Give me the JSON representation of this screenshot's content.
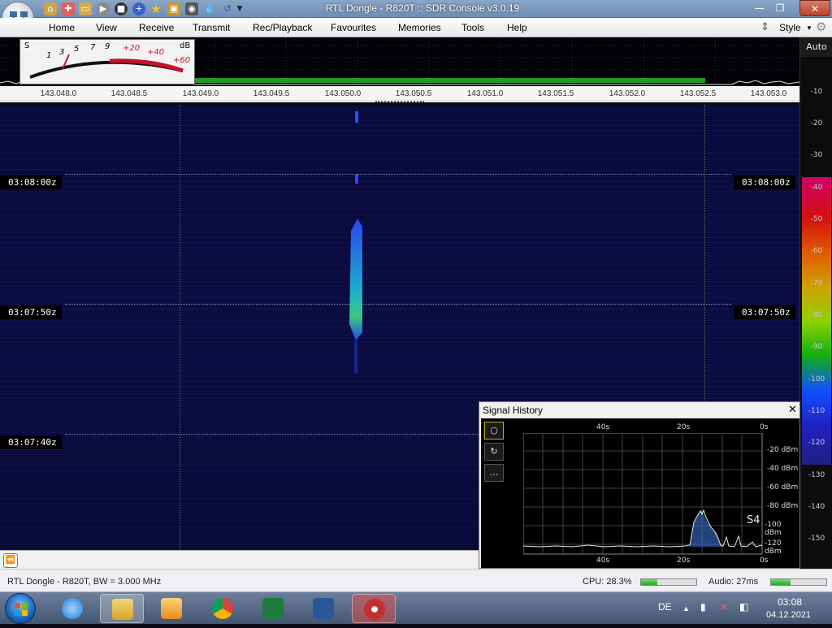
{
  "window": {
    "title": "RTL Dongle - R820T :: SDR Console v3.0.19",
    "style_label": "Style"
  },
  "menu": [
    "Home",
    "View",
    "Receive",
    "Transmit",
    "Rec/Playback",
    "Favourites",
    "Memories",
    "Tools",
    "Help"
  ],
  "smeter": {
    "s_label": "S",
    "db_label": "dB",
    "s_scale": [
      "1",
      "3",
      "5",
      "7",
      "9"
    ],
    "db_scale": [
      "+20",
      "+40",
      "+60"
    ]
  },
  "frequency_axis": [
    "143.048.0",
    "143.048.5",
    "143.049.0",
    "143.049.5",
    "143.050.0",
    "143.050.5",
    "143.051.0",
    "143.051.5",
    "143.052.0",
    "143.052.5",
    "143.053.0"
  ],
  "db_scale": {
    "auto_label": "Auto",
    "labels": [
      "-10",
      "-20",
      "-30",
      "-40",
      "-50",
      "-60",
      "-70",
      "-80",
      "-90",
      "-100",
      "-110",
      "-120",
      "-130",
      "-140",
      "-150"
    ],
    "colors": [
      "#d0006a",
      "#d01010",
      "#e05a00",
      "#d0a000",
      "#8fd000",
      "#10b010",
      "#1050ff",
      "#2020c0",
      "#2020a0"
    ]
  },
  "waterfall": {
    "time_labels": [
      "03:08:00z",
      "03:07:50z",
      "03:07:40z"
    ]
  },
  "signal_history": {
    "title": "Signal History",
    "close": "✕",
    "x_labels": [
      "40s",
      "20s",
      "0s"
    ],
    "y_labels": [
      "-20 dBm",
      "-40 dBm",
      "-60 dBm",
      "-80 dBm",
      "-100 dBm",
      "-120 dBm"
    ],
    "s_reading": "S4",
    "buttons": [
      "○",
      "↻",
      "…"
    ]
  },
  "status": {
    "device": "RTL Dongle - R820T, BW = 3.000 MHz",
    "cpu": "CPU: 28.3%",
    "cpu_fraction": 0.3,
    "audio": "Audio: 27ms",
    "audio_fraction": 0.35
  },
  "taskbar": {
    "language": "DE",
    "time": "03:08",
    "date": "04.12.2021"
  },
  "icons": [
    "app-orb-icon",
    "home-icon",
    "help-icon",
    "folder-icon",
    "play-icon",
    "stop-icon",
    "add-icon",
    "favourite-icon",
    "lock-icon",
    "camera-icon",
    "drop-icon",
    "refresh-icon",
    "gear-icon",
    "windows-start-icon",
    "ie-icon",
    "explorer-icon",
    "media-icon",
    "chrome-icon",
    "excel-icon",
    "word-icon",
    "sdr-icon"
  ]
}
